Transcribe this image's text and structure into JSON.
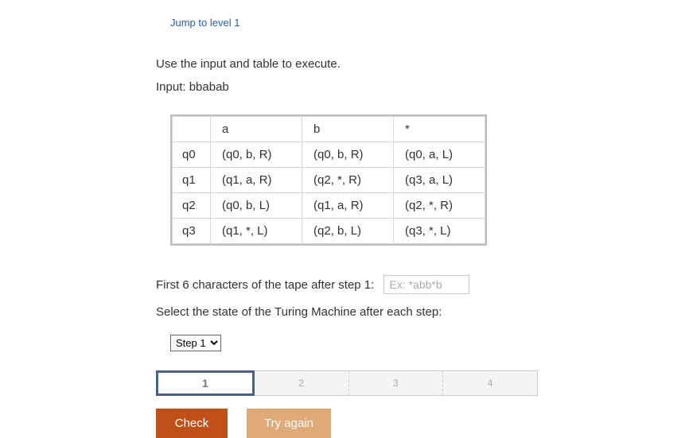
{
  "jump_link": "Jump to level 1",
  "instruction": "Use the input and table to execute.",
  "input_label": "Input: bbabab",
  "table": {
    "headers": [
      "",
      "a",
      "b",
      "*"
    ],
    "rows": [
      {
        "label": "q0",
        "cells": [
          "(q0, b, R)",
          "(q0, b, R)",
          "(q0, a, L)"
        ]
      },
      {
        "label": "q1",
        "cells": [
          "(q1, a, R)",
          "(q2, *, R)",
          "(q3, a, L)"
        ]
      },
      {
        "label": "q2",
        "cells": [
          "(q0, b, L)",
          "(q1, a, R)",
          "(q2, *, R)"
        ]
      },
      {
        "label": "q3",
        "cells": [
          "(q1, *, L)",
          "(q2, b, L)",
          "(q3, *, L)"
        ]
      }
    ]
  },
  "tape_prompt": "First 6 characters of the tape after step 1:",
  "tape_placeholder": "Ex: *abb*b",
  "state_prompt": "Select the state of the Turing Machine after each step:",
  "step_select": {
    "selected": "Step 1"
  },
  "steps_bar": [
    "1",
    "2",
    "3",
    "4"
  ],
  "active_step_index": 0,
  "buttons": {
    "check": "Check",
    "try_again": "Try again"
  }
}
